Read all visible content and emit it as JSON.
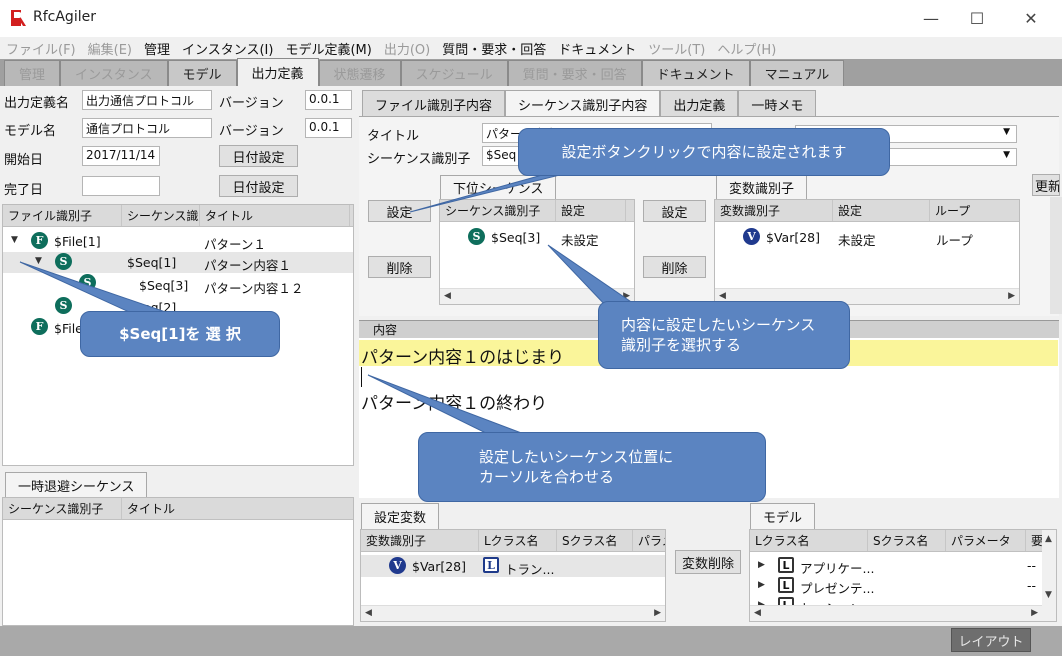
{
  "app": {
    "title": "RfcAgiler"
  },
  "menu": [
    "ファイル(F)",
    "編集(E)",
    "管理",
    "インスタンス(I)",
    "モデル定義(M)",
    "出力(O)",
    "質問・要求・回答",
    "ドキュメント",
    "ツール(T)",
    "ヘルプ(H)"
  ],
  "main_tabs": [
    "管理",
    "インスタンス",
    "モデル",
    "出力定義",
    "状態遷移",
    "スケジュール",
    "質問・要求・回答",
    "ドキュメント",
    "マニュアル"
  ],
  "form": {
    "output_def_label": "出力定義名",
    "output_def_value": "出力通信プロトコル",
    "version_label_1": "バージョン",
    "version_value_1": "0.0.1",
    "model_label": "モデル名",
    "model_value": "通信プロトコル",
    "version_label_2": "バージョン",
    "version_value_2": "0.0.1",
    "start_label": "開始日",
    "start_value": "2017/11/14",
    "start_button": "日付設定",
    "end_label": "完了日",
    "end_value": "",
    "end_button": "日付設定"
  },
  "tree": {
    "headers": [
      "ファイル識別子",
      "シーケンス識別子",
      "タイトル"
    ],
    "rows": [
      {
        "icon": "F",
        "id": "$File[1]",
        "title": "パターン１"
      },
      {
        "icon": "S",
        "id": "$Seq[1]",
        "title": "パターン内容１"
      },
      {
        "icon": "S",
        "id": "$Seq[3]",
        "title": "パターン内容１２"
      },
      {
        "icon": "S",
        "id": "$Seq[2]",
        "title": ""
      },
      {
        "icon": "F",
        "id": "$File[",
        "title": ""
      }
    ]
  },
  "temp_seq": {
    "tab": "一時退避シーケンス",
    "headers": [
      "シーケンス識別子",
      "タイトル"
    ]
  },
  "sub_tabs": [
    "ファイル識別子内容",
    "シーケンス識別子内容",
    "出力定義",
    "一時メモ"
  ],
  "seq_content": {
    "title_label": "タイトル",
    "title_value": "パターン内容１",
    "seqid_label": "シーケンス識別子",
    "seqid_value": "$Seq",
    "set_button": "設定",
    "delete_button": "削除",
    "sub_seq_tab": "下位シーケンス",
    "sub_seq_headers": [
      "シーケンス識別子",
      "設定"
    ],
    "sub_seq_rows": [
      {
        "icon": "S",
        "id": "$Seq[3]",
        "setting": "未設定"
      }
    ],
    "set_button_2": "設定",
    "delete_button_2": "削除",
    "var_tab": "変数識別子",
    "var_headers": [
      "変数識別子",
      "設定",
      "ループ"
    ],
    "var_rows": [
      {
        "icon": "V",
        "id": "$Var[28]",
        "setting": "未設定",
        "loop": "ループ"
      }
    ],
    "refresh_button": "更新"
  },
  "content": {
    "label": "内容",
    "line1": "パターン内容１のはじまり",
    "line3": "パターン内容１の終わり"
  },
  "set_vars": {
    "tab": "設定変数",
    "headers": [
      "変数識別子",
      "Lクラス名",
      "Sクラス名",
      "パラメ"
    ],
    "rows": [
      {
        "icon": "V",
        "id": "$Var[28]",
        "lclass": "トラン..."
      }
    ],
    "delete_button": "変数削除"
  },
  "model": {
    "tab": "モデル",
    "headers": [
      "Lクラス名",
      "Sクラス名",
      "パラメータ",
      "要"
    ],
    "rows": [
      {
        "icon": "L",
        "name": "アプリケー...",
        "extra": "--"
      },
      {
        "icon": "L",
        "name": "プレゼンテ...",
        "extra": "--"
      },
      {
        "icon": "L",
        "name": "セッション...",
        "extra": "--"
      }
    ]
  },
  "status": {
    "layout_button": "レイアウト"
  },
  "callouts": {
    "c1": "設定ボタンクリックで内容に設定されます",
    "c2": "$Seq[1]を 選 択",
    "c3a": "内容に設定したいシーケンス",
    "c3b": "識別子を選択する",
    "c4a": "設定したいシーケンス位置に",
    "c4b": "カーソルを合わせる"
  },
  "colors": {
    "highlight": "#faf59a",
    "callout": "#5b84c1",
    "seq_icon": "#0e6e5c",
    "var_icon": "#203a8e"
  }
}
